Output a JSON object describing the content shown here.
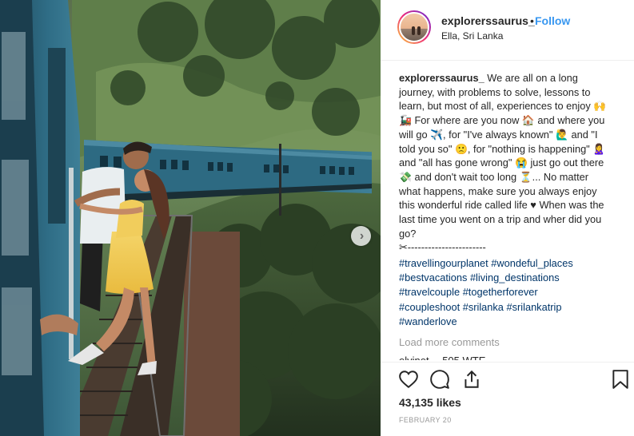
{
  "post": {
    "username": "explorerssaurus_",
    "separator": "•",
    "follow_label": "Follow",
    "location": "Ella, Sri Lanka"
  },
  "caption": {
    "username": "explorerssaurus_",
    "line1": "We are all on a long journey, with problems to solve, lessons to learn, but most of all, experiences to enjoy 🙌🚂 For where are you now 🏠 and where you will go ✈️, for \"I've always known\" 🙋‍♂️ and \"I told you so\" 🙁, for \"nothing is happening\" 🙎‍♀️ and \"all has gone wrong\" 😭 just go out there 💸 and don't wait too long ⏳... No matter what happens, make sure you always enjoy this wonderful ride called life ♥ When was the last time you went on a trip and wher did you go?",
    "divider": "✂-----------------------"
  },
  "hashtags": [
    "#travellingourplanet",
    "#wondeful_places",
    "#bestvacations",
    "#living_destinations",
    "#travelcouple",
    "#togetherforever",
    "#coupleshoot",
    "#srilanka",
    "#srilankatrip",
    "#wanderlove"
  ],
  "comments": {
    "load_more": "Load more comments",
    "clipped_row": "elyinet… 505 WTE"
  },
  "actions": {
    "like_icon": "heart-icon",
    "comment_icon": "comment-bubble-icon",
    "share_icon": "share-icon",
    "save_icon": "bookmark-icon"
  },
  "likes": "43,135 likes",
  "date": "FEBRUARY 20",
  "carousel": {
    "next_icon": "chevron-right-icon"
  },
  "colors": {
    "link": "#3897f0",
    "hashtag": "#003569",
    "muted": "#999999",
    "train_blue": "#2f6d86"
  }
}
